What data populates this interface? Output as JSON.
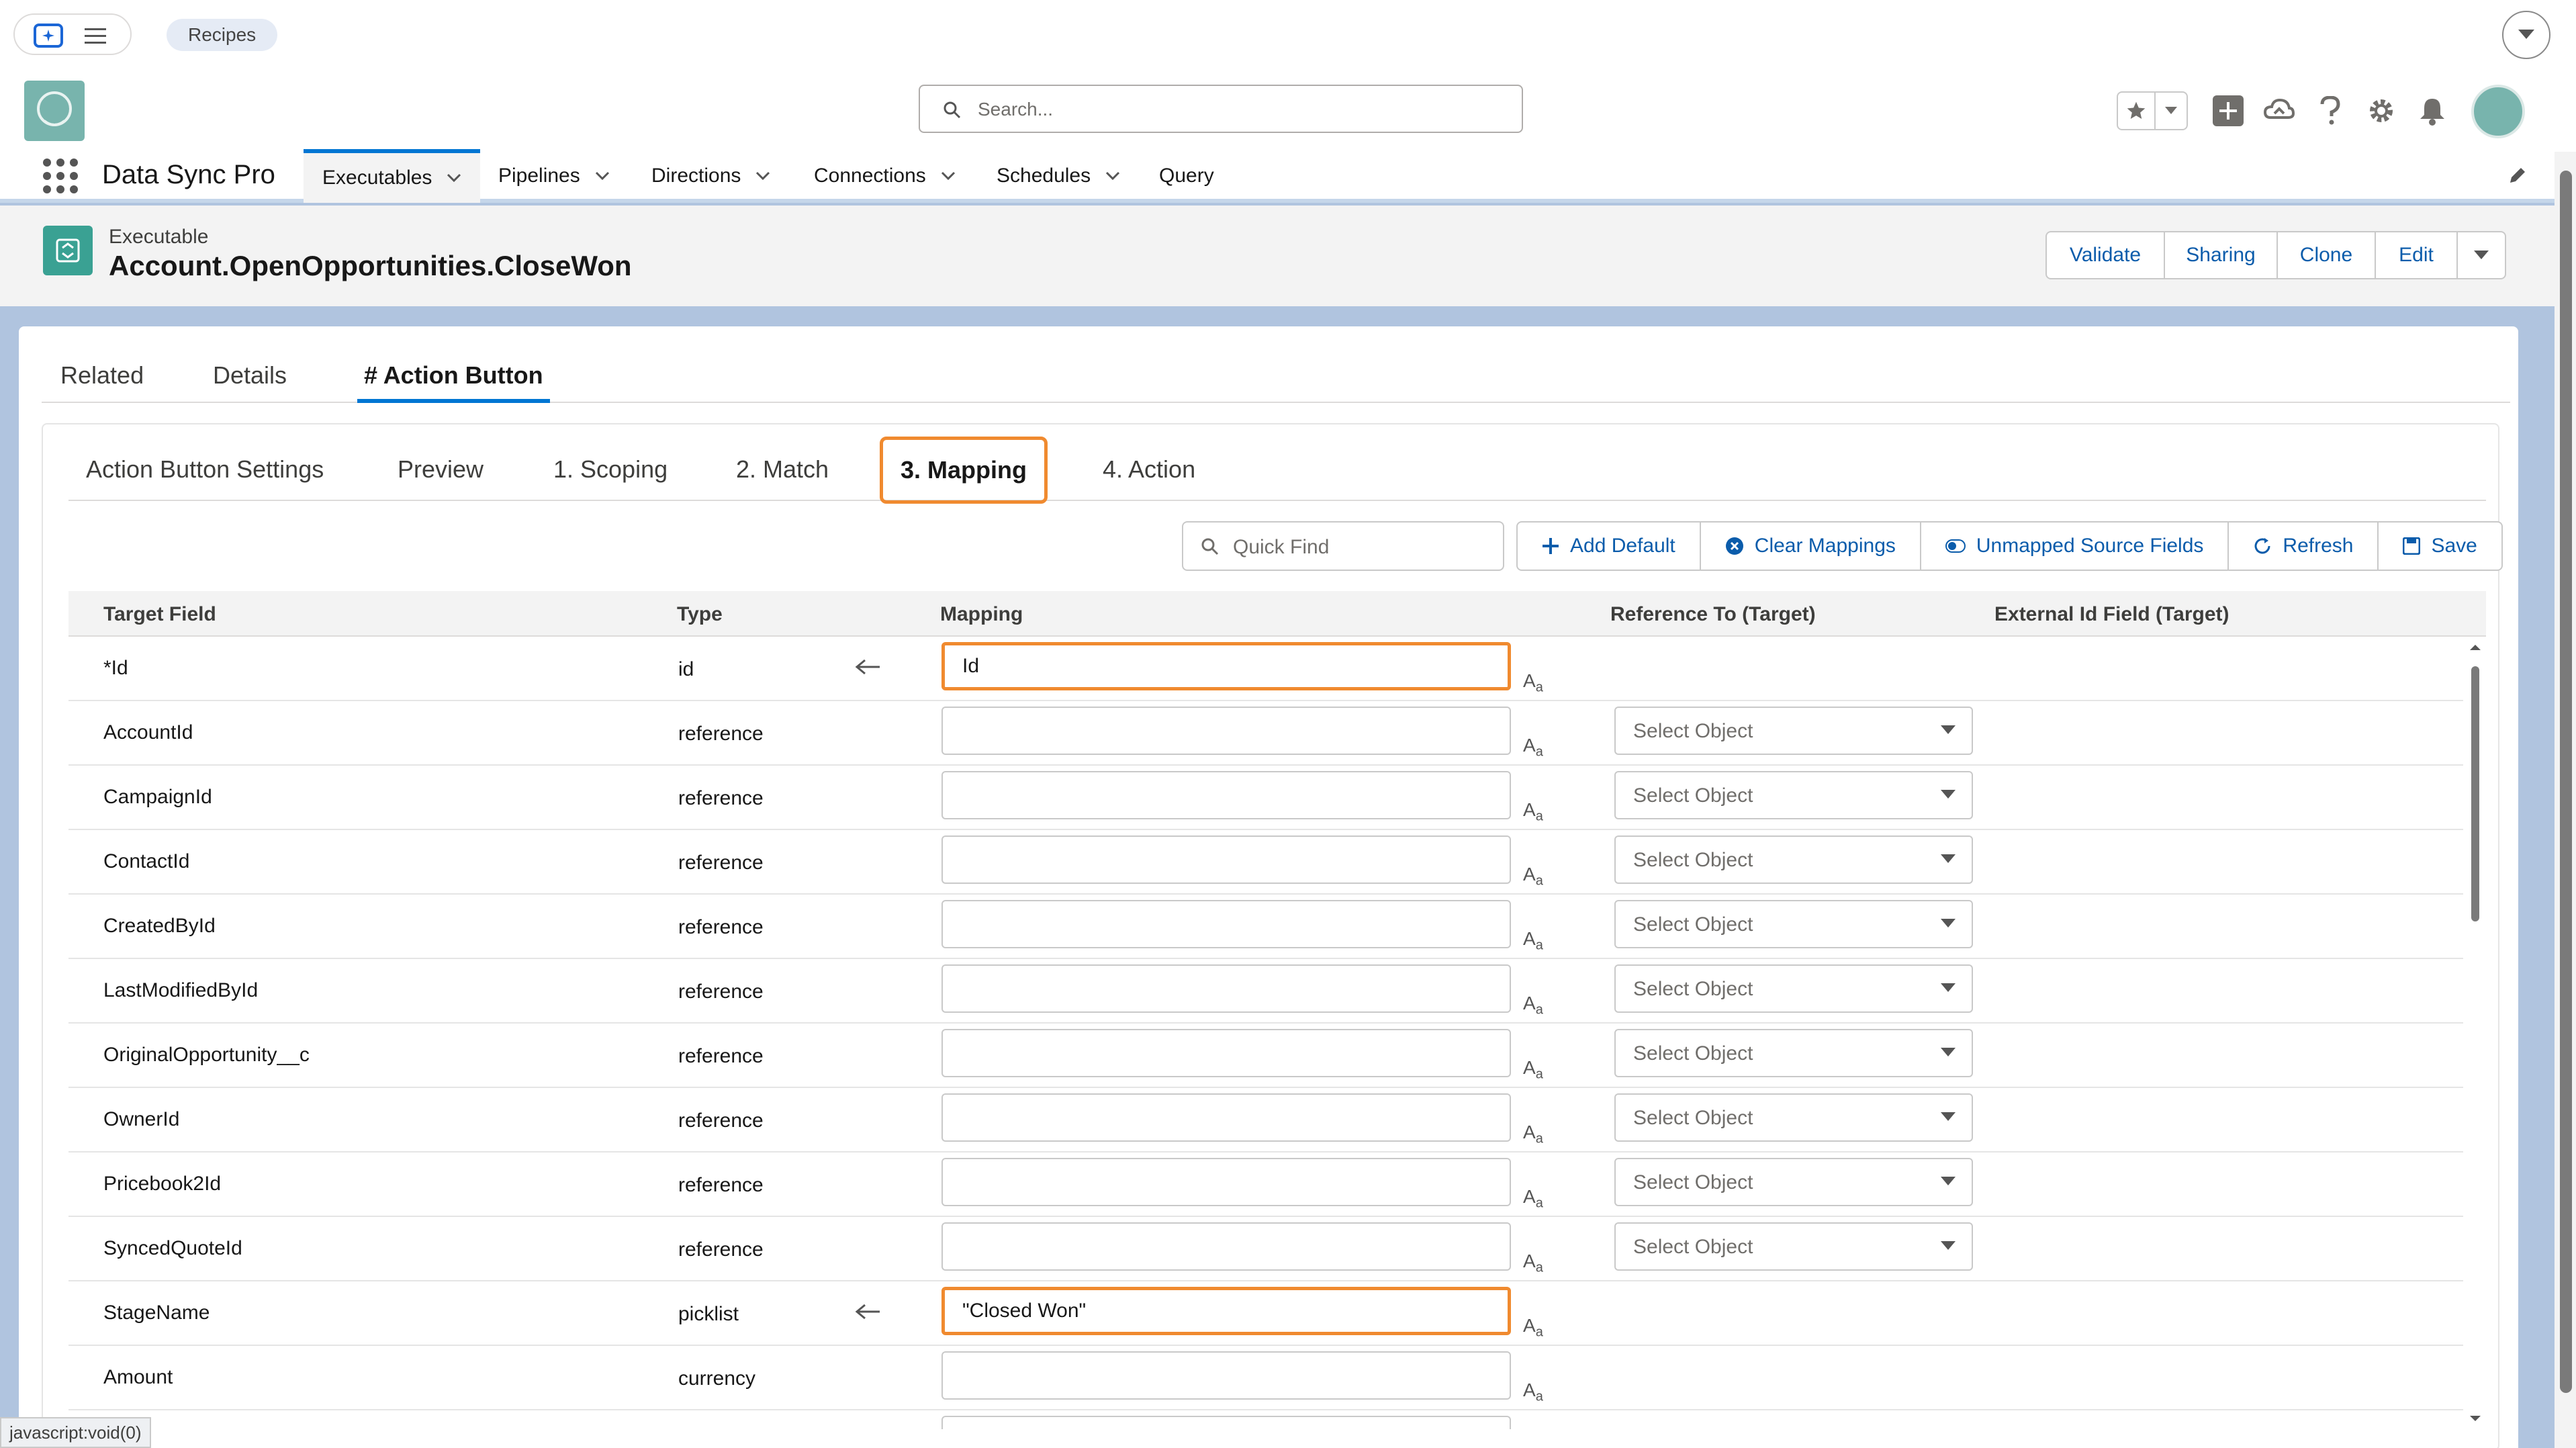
{
  "topbar": {
    "recipes_label": "Recipes"
  },
  "header": {
    "search_placeholder": "Search..."
  },
  "nav": {
    "app_name": "Data Sync Pro",
    "items": [
      {
        "label": "Executables",
        "has_chevron": true,
        "active": true
      },
      {
        "label": "Pipelines",
        "has_chevron": true
      },
      {
        "label": "Directions",
        "has_chevron": true
      },
      {
        "label": "Connections",
        "has_chevron": true
      },
      {
        "label": "Schedules",
        "has_chevron": true
      },
      {
        "label": "Query",
        "has_chevron": false
      }
    ]
  },
  "record": {
    "type_label": "Executable",
    "title": "Account.OpenOpportunities.CloseWon",
    "actions": [
      "Validate",
      "Sharing",
      "Clone",
      "Edit"
    ]
  },
  "record_tabs": [
    "Related",
    "Details",
    "# Action Button"
  ],
  "record_tabs_active": "# Action Button",
  "inner_tabs": [
    "Action Button Settings",
    "Preview",
    "1. Scoping",
    "2. Match",
    "3. Mapping",
    "4. Action"
  ],
  "inner_tabs_active": "3. Mapping",
  "toolbar": {
    "quick_find_placeholder": "Quick Find",
    "add_default": "Add Default",
    "clear_mappings": "Clear Mappings",
    "unmapped_source_fields": "Unmapped Source Fields",
    "refresh": "Refresh",
    "save": "Save"
  },
  "table": {
    "columns": {
      "target_field": "Target Field",
      "type": "Type",
      "mapping": "Mapping",
      "reference_to": "Reference To (Target)",
      "external_id": "External Id Field (Target)"
    },
    "rows": [
      {
        "field": "*Id",
        "type": "id",
        "mapped": true,
        "mapping": "Id",
        "select": null
      },
      {
        "field": "AccountId",
        "type": "reference",
        "mapped": false,
        "mapping": "",
        "select": "Select Object"
      },
      {
        "field": "CampaignId",
        "type": "reference",
        "mapped": false,
        "mapping": "",
        "select": "Select Object"
      },
      {
        "field": "ContactId",
        "type": "reference",
        "mapped": false,
        "mapping": "",
        "select": "Select Object"
      },
      {
        "field": "CreatedById",
        "type": "reference",
        "mapped": false,
        "mapping": "",
        "select": "Select Object"
      },
      {
        "field": "LastModifiedById",
        "type": "reference",
        "mapped": false,
        "mapping": "",
        "select": "Select Object"
      },
      {
        "field": "OriginalOpportunity__c",
        "type": "reference",
        "mapped": false,
        "mapping": "",
        "select": "Select Object"
      },
      {
        "field": "OwnerId",
        "type": "reference",
        "mapped": false,
        "mapping": "",
        "select": "Select Object"
      },
      {
        "field": "Pricebook2Id",
        "type": "reference",
        "mapped": false,
        "mapping": "",
        "select": "Select Object"
      },
      {
        "field": "SyncedQuoteId",
        "type": "reference",
        "mapped": false,
        "mapping": "",
        "select": "Select Object"
      },
      {
        "field": "StageName",
        "type": "picklist",
        "mapped": true,
        "mapping": "\"Closed Won\"",
        "select": null
      },
      {
        "field": "Amount",
        "type": "currency",
        "mapped": false,
        "mapping": "",
        "select": null
      },
      {
        "field": "",
        "type": "",
        "mapped": false,
        "mapping": "",
        "select": null
      }
    ]
  },
  "status_bar": "javascript:void(0)",
  "colors": {
    "accent": "#0176d3",
    "highlight": "#f08a2f",
    "record_icon": "#3aa193",
    "link": "#0b5cab"
  },
  "icons": [
    "app-launcher-icon",
    "hamburger-icon",
    "search-icon",
    "star-icon",
    "plus-icon",
    "cloud-icon",
    "help-icon",
    "gear-icon",
    "bell-icon",
    "pencil-icon",
    "arrow-left-icon",
    "text-format-icon"
  ]
}
